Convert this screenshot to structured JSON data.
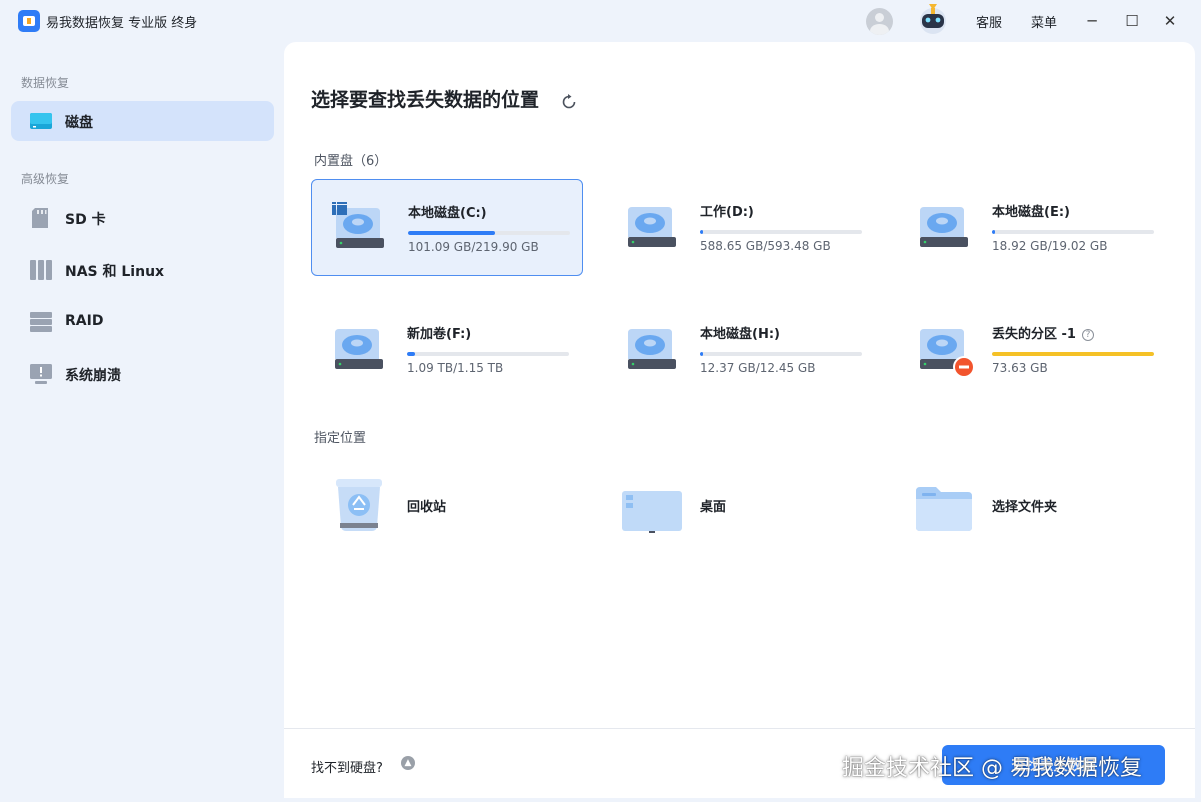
{
  "app": {
    "title": "易我数据恢复 专业版 终身"
  },
  "titlebar": {
    "support_label": "客服",
    "menu_label": "菜单",
    "minimize": "─",
    "maximize": "☐",
    "close": "✕"
  },
  "sidebar": {
    "section_data": "数据恢复",
    "section_advanced": "高级恢复",
    "items": [
      {
        "label": "磁盘"
      },
      {
        "label": "SD 卡"
      },
      {
        "label": "NAS 和 Linux"
      },
      {
        "label": "RAID"
      },
      {
        "label": "系统崩溃"
      }
    ]
  },
  "main": {
    "title": "选择要查找丢失数据的位置",
    "internal_label": "内置盘（6）",
    "drives": [
      {
        "name": "本地磁盘(C:)",
        "size": "101.09 GB/219.90 GB",
        "usage": 0.54
      },
      {
        "name": "工作(D:)",
        "size": "588.65 GB/593.48 GB",
        "usage": 0.02
      },
      {
        "name": "本地磁盘(E:)",
        "size": "18.92 GB/19.02 GB",
        "usage": 0.02
      },
      {
        "name": "新加卷(F:)",
        "size": "1.09 TB/1.15 TB",
        "usage": 0.05
      },
      {
        "name": "本地磁盘(H:)",
        "size": "12.37 GB/12.45 GB",
        "usage": 0.02
      },
      {
        "name": "丢失的分区 -1",
        "size": "73.63 GB",
        "usage": 1.0,
        "help": "?"
      }
    ],
    "locations_label": "指定位置",
    "locations": [
      {
        "label": "回收站"
      },
      {
        "label": "桌面"
      },
      {
        "label": "选择文件夹"
      }
    ],
    "footer": {
      "cannot_find": "找不到硬盘?",
      "scan_button": "查找丢失数据"
    }
  },
  "watermark": "掘金技术社区 @ 易我数据恢复",
  "colors": {
    "accent": "#2e7cf6",
    "lost_partition_bar": "#f5c126",
    "selected_bg": "#e8f0fc",
    "error_badge": "#f2542d"
  }
}
